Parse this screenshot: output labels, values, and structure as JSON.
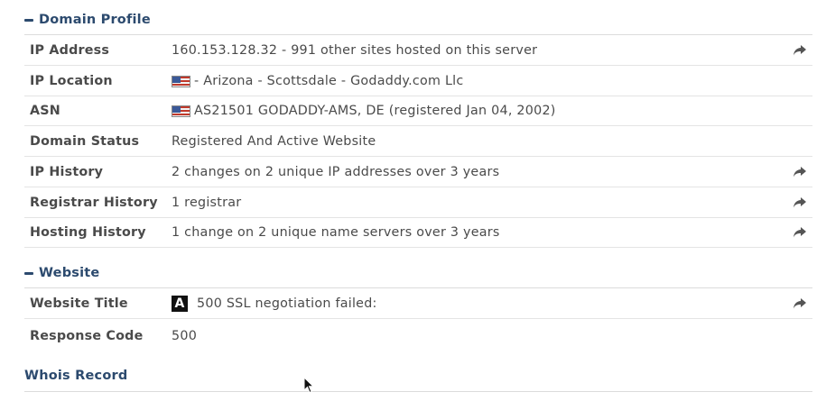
{
  "sections": {
    "domain_profile": "Domain Profile",
    "website": "Website",
    "whois": "Whois Record"
  },
  "domain_profile": {
    "ip_address": {
      "label": "IP Address",
      "value": "160.153.128.32 - 991 other sites hosted on this server"
    },
    "ip_location": {
      "label": "IP Location",
      "value": "- Arizona - Scottsdale - Godaddy.com Llc",
      "flag_icon": "us-flag-icon"
    },
    "asn": {
      "label": "ASN",
      "value": "AS21501 GODADDY-AMS, DE (registered Jan 04, 2002)",
      "flag_icon": "us-flag-icon"
    },
    "domain_status": {
      "label": "Domain Status",
      "value": "Registered And Active Website"
    },
    "ip_history": {
      "label": "IP History",
      "value": "2 changes on 2 unique IP addresses over 3 years"
    },
    "registrar_history": {
      "label": "Registrar History",
      "value": "1 registrar"
    },
    "hosting_history": {
      "label": "Hosting History",
      "value": "1 change on 2 unique name servers over 3 years"
    }
  },
  "website": {
    "website_title": {
      "label": "Website Title",
      "value": "500 SSL negotiation failed:",
      "icon": "A"
    },
    "response_code": {
      "label": "Response Code",
      "value": "500"
    }
  },
  "colors": {
    "section_heading": "#2c4a6e",
    "text": "#4a4a4a",
    "rule": "#dcdcdc"
  }
}
